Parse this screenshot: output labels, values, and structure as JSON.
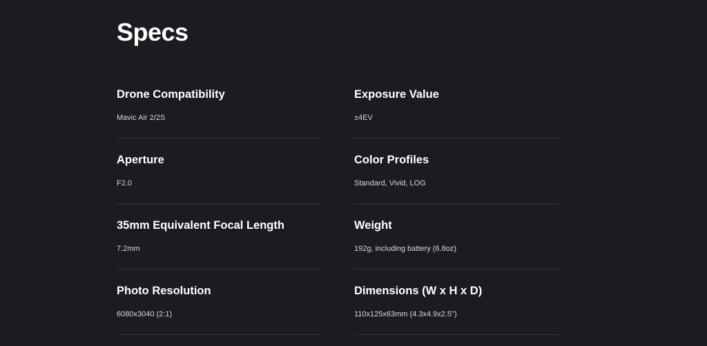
{
  "section": {
    "title": "Specs"
  },
  "specs": [
    {
      "label": "Drone Compatibility",
      "value": "Mavic Air 2/2S"
    },
    {
      "label": "Exposure Value",
      "value": "±4EV"
    },
    {
      "label": "Aperture",
      "value": "F2.0"
    },
    {
      "label": "Color Profiles",
      "value": "Standard, Vivid, LOG"
    },
    {
      "label": "35mm Equivalent Focal Length",
      "value": "7.2mm"
    },
    {
      "label": "Weight",
      "value": "192g, including battery (6.8oz)"
    },
    {
      "label": "Photo Resolution",
      "value": "6080x3040 (2:1)"
    },
    {
      "label": "Dimensions (W x H x D)",
      "value": "110x125x63mm (4.3x4.9x2.5\")"
    }
  ],
  "colors": {
    "background": "#1b1c20",
    "heading": "#ffffff",
    "value_text": "#d9d9dc",
    "divider": "#34353a"
  }
}
